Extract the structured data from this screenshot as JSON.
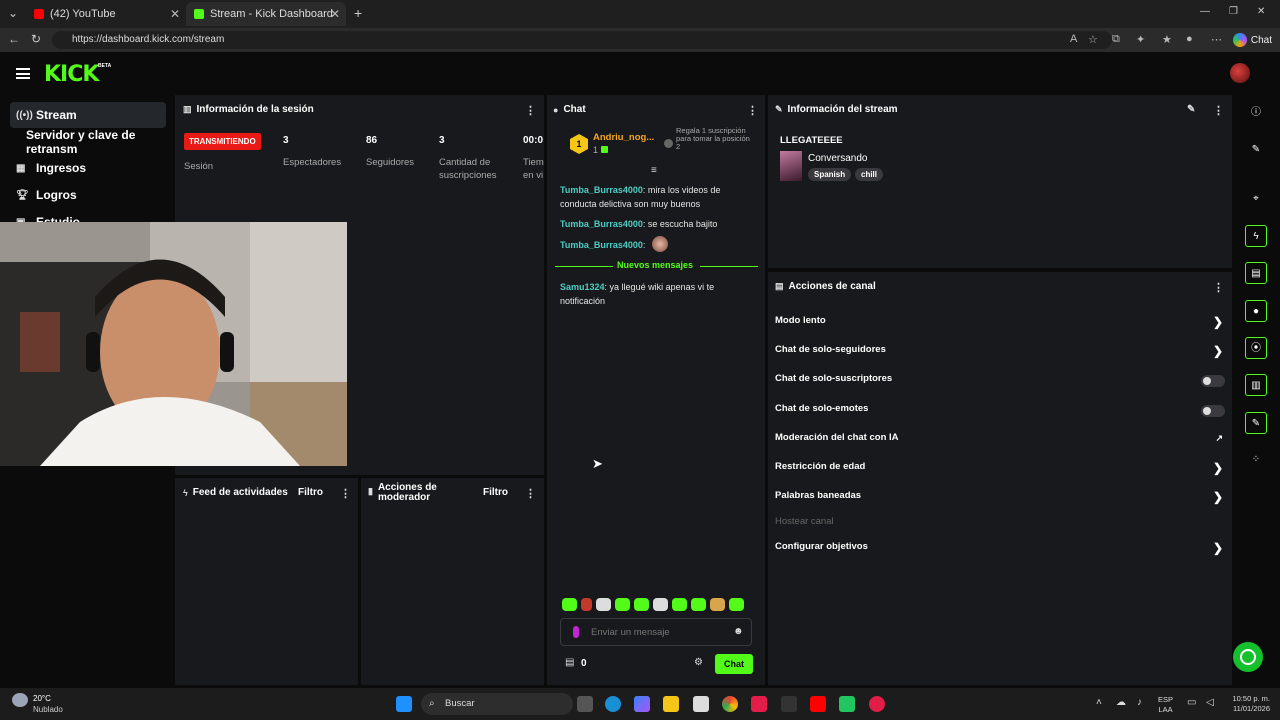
{
  "browser": {
    "tabs": [
      {
        "label": "(42) YouTube",
        "color": "#ff0000"
      },
      {
        "label": "Stream - Kick Dashboard",
        "color": "#53fc18"
      }
    ],
    "url": "https://dashboard.kick.com/stream",
    "copilot_label": "Chat"
  },
  "app": {
    "logo": "KICK",
    "beta": "BETA",
    "accent": "#53fc18"
  },
  "nav": {
    "items": [
      {
        "label": "Stream",
        "icon": "broadcast-icon"
      },
      {
        "label": "Servidor y clave de retransm",
        "icon": ""
      },
      {
        "label": "Ingresos",
        "icon": "wallet-icon"
      },
      {
        "label": "Logros",
        "icon": "trophy-icon"
      },
      {
        "label": "Estudio",
        "icon": "studio-icon"
      }
    ]
  },
  "session": {
    "title": "Información de la sesión",
    "badge": "TRANSMITIENDO",
    "badge_sublabel": "Sesión",
    "stats": [
      {
        "value": "3",
        "label": "Espectadores"
      },
      {
        "value": "86",
        "label": "Seguidores"
      },
      {
        "value": "3",
        "label": "Cantidad de suscripciones"
      },
      {
        "value": "00:0",
        "label": "Tiem en vi"
      }
    ]
  },
  "chat": {
    "title": "Chat",
    "top_gifter": {
      "rank": "1",
      "name": "Andriu_nog...",
      "count": "1"
    },
    "gift_prompt": "Regala 1 suscripción para tomar la posición 2",
    "messages": [
      {
        "user": "Tumba_Burras4000",
        "text": "mira los videos de conducta delictiva son muy buenos"
      },
      {
        "user": "Tumba_Burras4000",
        "text": "se escucha bajito"
      },
      {
        "user": "Tumba_Burras4000",
        "text": ""
      }
    ],
    "new_messages_label": "Nuevos mensajes",
    "new_messages": [
      {
        "user": "Samu1324",
        "text": "ya llegué wiki apenas vi te notificación"
      }
    ],
    "input_placeholder": "Enviar un mensaje",
    "points": "0",
    "send_label": "Chat"
  },
  "stream_info": {
    "title": "Información del stream",
    "stream_title": "LLEGATEEEE",
    "category": "Conversando",
    "tags": [
      "Spanish",
      "chill"
    ]
  },
  "channel_actions": {
    "title": "Acciones de canal",
    "items": [
      {
        "label": "Modo lento",
        "control": "arrow"
      },
      {
        "label": "Chat de solo-seguidores",
        "control": "arrow"
      },
      {
        "label": "Chat de solo-suscriptores",
        "control": "toggle",
        "enabled": false
      },
      {
        "label": "Chat de solo-emotes",
        "control": "toggle",
        "enabled": false
      },
      {
        "label": "Moderación del chat con IA",
        "control": "external"
      },
      {
        "label": "Restricción de edad",
        "control": "arrow"
      },
      {
        "label": "Palabras baneadas",
        "control": "arrow"
      },
      {
        "label": "Hostear canal",
        "control": "none"
      },
      {
        "label": "Configurar objetivos",
        "control": "arrow"
      }
    ]
  },
  "activity_feed": {
    "title": "Feed de actividades",
    "filter": "Filtro"
  },
  "mod_actions": {
    "title": "Acciones de moderador",
    "filter": "Filtro"
  },
  "taskbar": {
    "weather_temp": "20°C",
    "weather_desc": "Nublado",
    "search_placeholder": "Buscar",
    "lang": "ESP",
    "lang_sub": "LAA",
    "time": "10:50 p. m.",
    "date": "11/01/2026"
  }
}
